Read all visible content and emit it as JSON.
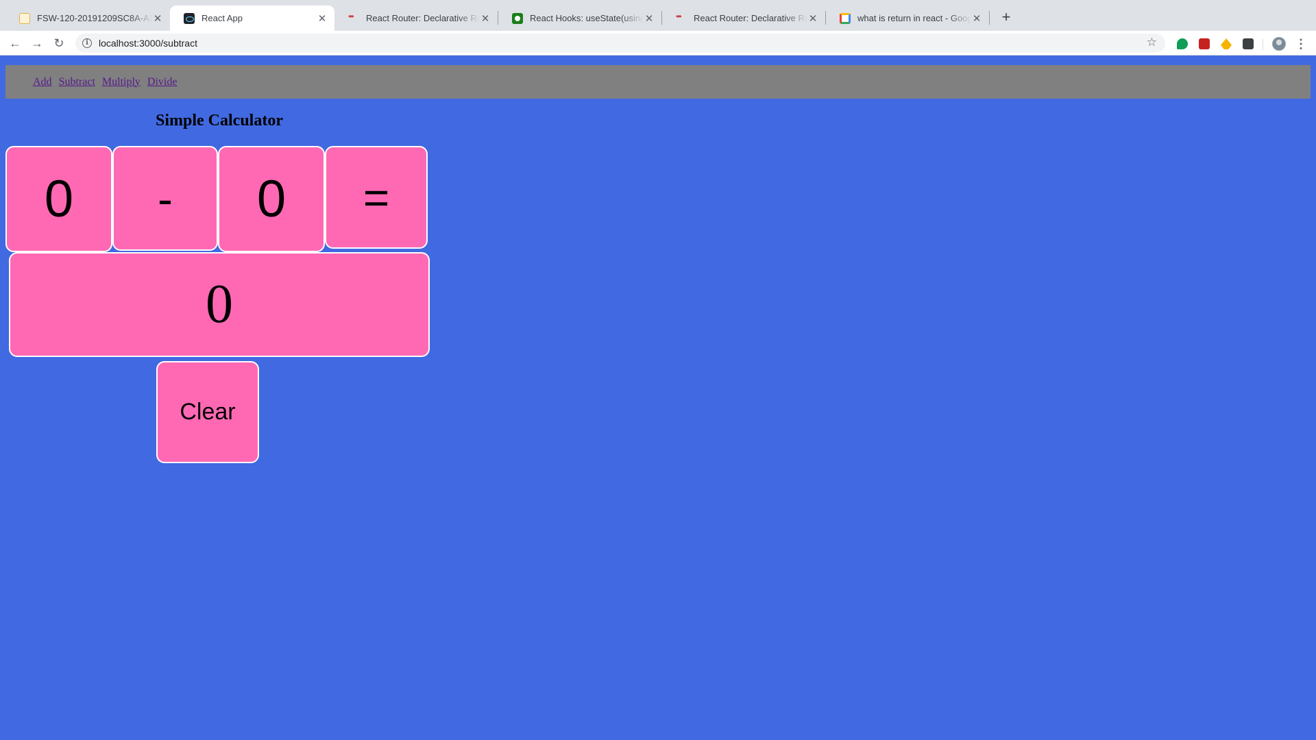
{
  "browser": {
    "tabs": [
      {
        "title": "FSW-120-20191209SC8A-A2",
        "icon": "document-favicon-icon"
      },
      {
        "title": "React App",
        "icon": "react-favicon-icon"
      },
      {
        "title": "React Router: Declarative Rout",
        "icon": "react-router-favicon-icon"
      },
      {
        "title": "React Hooks: useState(using th",
        "icon": "hooks-favicon-icon"
      },
      {
        "title": "React Router: Declarative Rout",
        "icon": "react-router-favicon-icon"
      },
      {
        "title": "what is return in react - Google",
        "icon": "google-favicon-icon"
      }
    ],
    "active_tab": 1,
    "close_glyph": "✕",
    "new_tab_glyph": "+",
    "nav": {
      "back": "←",
      "forward": "→",
      "reload": "↻"
    },
    "url": "localhost:3000/subtract",
    "info_glyph": "i",
    "star_glyph": "☆",
    "menu_glyph": "⋮"
  },
  "navbar": {
    "links": [
      "Add",
      "Subtract",
      "Multiply",
      "Divide"
    ]
  },
  "calculator": {
    "title": "Simple Calculator",
    "first_operand": "0",
    "operator": "-",
    "second_operand": "0",
    "equals": "=",
    "result": "0",
    "clear_label": "Clear"
  },
  "colors": {
    "page_background": "#4169e1",
    "navbar_background": "#808080",
    "key_background": "#ff69b4",
    "key_border": "#ffffff",
    "link_color": "#551a8b"
  }
}
